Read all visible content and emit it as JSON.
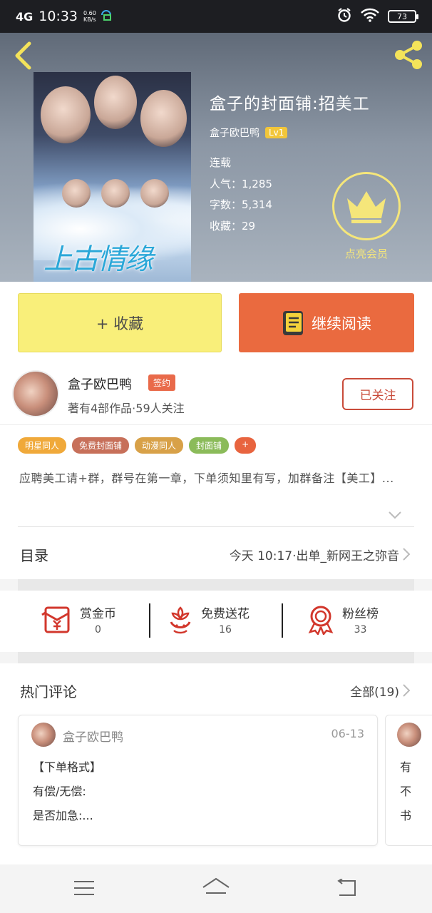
{
  "status_bar": {
    "network": "4G",
    "time": "10:33",
    "speed_value": "0.60",
    "speed_unit": "KB/s",
    "battery": "73"
  },
  "book": {
    "title": "盒子的封面铺:招美工",
    "author": "盒子欧巴鸭",
    "level": "Lv1",
    "status": "连载",
    "popularity": "人气：1,285",
    "word_count": "字数：5,314",
    "favorites": "收藏：29",
    "cover_text": "上古情缘"
  },
  "vip": {
    "label": "点亮会员"
  },
  "actions": {
    "collect_label": "+ 收藏",
    "read_label": "继续阅读"
  },
  "author_section": {
    "name": "盒子欧巴鸭",
    "signed_badge": "签约",
    "description": "著有4部作品·59人关注",
    "follow_label": "已关注",
    "tags": [
      {
        "label": "明星同人",
        "color": "#f0a93a"
      },
      {
        "label": "免费封面铺",
        "color": "#c7705a"
      },
      {
        "label": "动漫同人",
        "color": "#d8a148"
      },
      {
        "label": "封面铺",
        "color": "#8bbb5a"
      },
      {
        "label": "+",
        "color": "#e8643f"
      }
    ],
    "intro": "应聘美工请+群，群号在第一章，下单须知里有写，加群备注【美工】..."
  },
  "catalog": {
    "label": "目录",
    "latest": "今天 10:17·出单_新网王之弥音"
  },
  "stats": [
    {
      "name": "赏金币",
      "value": "0",
      "icon": "red-envelope-icon"
    },
    {
      "name": "免费送花",
      "value": "16",
      "icon": "flower-icon"
    },
    {
      "name": "粉丝榜",
      "value": "33",
      "icon": "medal-icon"
    }
  ],
  "comments": {
    "title": "热门评论",
    "all_label": "全部(19)",
    "items": [
      {
        "user": "盒子欧巴鸭",
        "date": "06-13",
        "line1": "【下单格式】",
        "line2": "有偿/无偿:",
        "line3": "是否加急:..."
      },
      {
        "line1": "有",
        "line2": "不",
        "line3": "书"
      }
    ]
  },
  "colors": {
    "accent_orange": "#ea6a3f",
    "collect_yellow": "#f9ef7a",
    "vip_gold": "#f5e67a",
    "follow_red": "#c94b3a"
  }
}
